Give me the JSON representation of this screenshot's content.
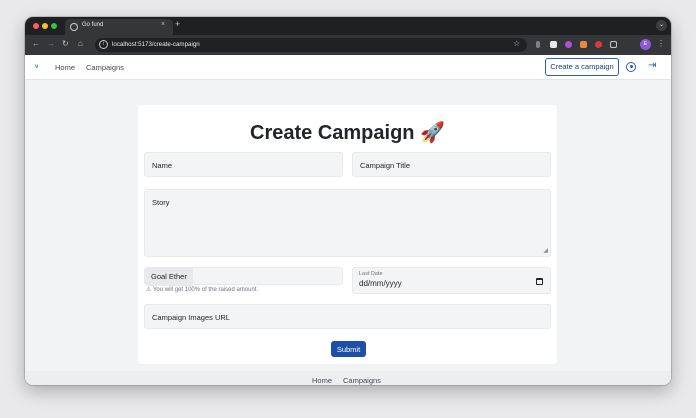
{
  "browser": {
    "tab_title": "Go fund",
    "tab_close": "×",
    "new_tab": "+",
    "url": "localhost:5173/create-campaign",
    "nav_icons": [
      "back-icon",
      "forward-icon",
      "reload-icon",
      "home-icon"
    ],
    "profile_initial": "E"
  },
  "nav": {
    "home": "Home",
    "separator": "·",
    "campaigns": "Campaigns",
    "create_button": "Create a campaign"
  },
  "form": {
    "title": "Create Campaign",
    "title_emoji": "🚀",
    "name_placeholder": "Name",
    "campaign_title_placeholder": "Campaign Title",
    "story_placeholder": "Story",
    "goal_label": "Goal Ether",
    "goal_hint": "You will get 100% of the raised amount.",
    "last_date_label": "Last Date",
    "last_date_value": "dd/mm/yyyy",
    "images_url_placeholder": "Campaign Images URL",
    "submit_label": "Submit"
  },
  "footer": {
    "home": "Home",
    "campaigns": "Campaigns"
  },
  "colors": {
    "accent": "#1e4fa8",
    "logo": "#1aa06d",
    "chrome_dark": "#1f2023",
    "page_bg": "#f2f3f5"
  }
}
